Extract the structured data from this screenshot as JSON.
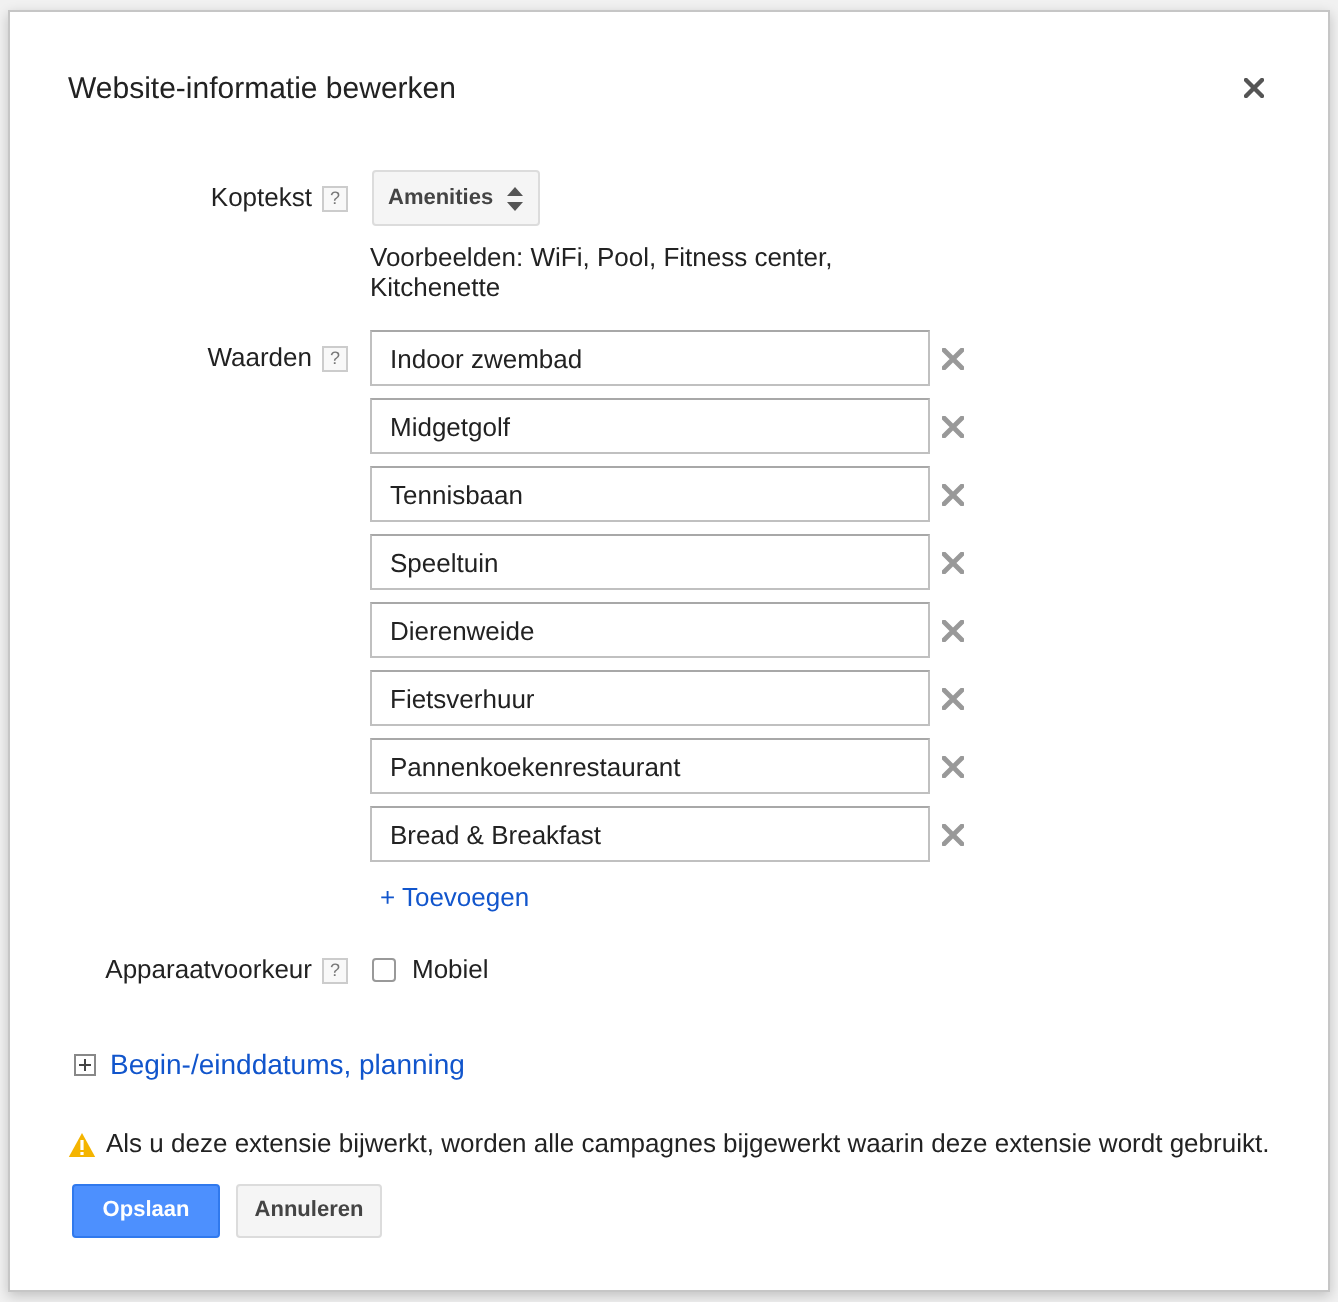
{
  "dialog": {
    "title": "Website-informatie bewerken"
  },
  "fields": [
    {
      "kind": "select",
      "label": "Koptekst",
      "help": "?",
      "value": "Amenities",
      "hint": "Voorbeelden: WiFi, Pool, Fitness center, Kitchenette"
    },
    {
      "kind": "values",
      "label": "Waarden",
      "help": "?",
      "values": [
        "Indoor zwembad",
        "Midgetgolf",
        "Tennisbaan",
        "Speeltuin",
        "Dierenweide",
        "Fietsverhuur",
        "Pannenkoekenrestaurant",
        "Bread & Breakfast"
      ],
      "add_link": "+ Toevoegen"
    },
    {
      "kind": "checkbox",
      "label": "Apparaatvoorkeur",
      "help": "?",
      "option": "Mobiel",
      "checked": false
    }
  ],
  "schedule": {
    "label": "Begin-/einddatums, planning",
    "expanded": false
  },
  "warning": "Als u deze extensie bijwerkt, worden alle campagnes bijgewerkt waarin deze extensie wordt gebruikt.",
  "buttons": [
    {
      "label": "Opslaan",
      "kind": "primary"
    },
    {
      "label": "Annuleren",
      "kind": "secondary"
    }
  ]
}
